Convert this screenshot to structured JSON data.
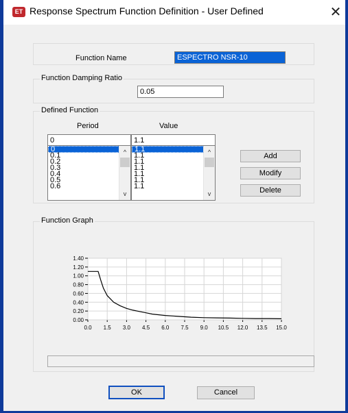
{
  "window": {
    "title": "Response Spectrum Function Definition - User Defined",
    "app_icon_text": "ET",
    "close_glyph": "✕"
  },
  "function_name": {
    "label": "Function Name",
    "value": "ESPECTRO NSR-10"
  },
  "damping": {
    "group_title": "Function Damping Ratio",
    "value": "0.05"
  },
  "defined_function": {
    "group_title": "Defined Function",
    "period_header": "Period",
    "value_header": "Value",
    "period_input": "0",
    "value_input": "1.1",
    "period_rows": [
      "0",
      "0.1",
      "0.2",
      "0.3",
      "0.4",
      "0.5",
      "0.6"
    ],
    "value_rows": [
      "1.1",
      "1.1",
      "1.1",
      "1.1",
      "1.1",
      "1.1",
      "1.1"
    ],
    "scroll_up_glyph": "^",
    "scroll_down_glyph": "v"
  },
  "buttons": {
    "add": "Add",
    "modify": "Modify",
    "delete": "Delete",
    "ok": "OK",
    "cancel": "Cancel"
  },
  "graph": {
    "group_title": "Function Graph"
  },
  "chart_data": {
    "type": "line",
    "title": "",
    "xlabel": "",
    "ylabel": "",
    "xlim": [
      0,
      15
    ],
    "ylim": [
      0,
      1.4
    ],
    "xticks": [
      "0.0",
      "1.5",
      "3.0",
      "4.5",
      "6.0",
      "7.5",
      "9.0",
      "10.5",
      "12.0",
      "13.5",
      "15.0"
    ],
    "yticks": [
      "0.00",
      "0.20",
      "0.40",
      "0.60",
      "0.80",
      "1.00",
      "1.20",
      "1.40"
    ],
    "grid": true,
    "series": [
      {
        "color": "#000000",
        "x": [
          0,
          0.5,
          0.8,
          1.0,
          1.2,
          1.5,
          2.0,
          2.5,
          3.0,
          3.5,
          4.0,
          4.5,
          5.0,
          6.0,
          7.0,
          8.0,
          9.0,
          10.0,
          11.0,
          12.0,
          13.0,
          14.0,
          15.0
        ],
        "y": [
          1.1,
          1.1,
          1.1,
          0.9,
          0.72,
          0.55,
          0.4,
          0.32,
          0.26,
          0.22,
          0.19,
          0.16,
          0.13,
          0.1,
          0.08,
          0.06,
          0.05,
          0.045,
          0.04,
          0.035,
          0.03,
          0.03,
          0.025
        ]
      }
    ]
  }
}
